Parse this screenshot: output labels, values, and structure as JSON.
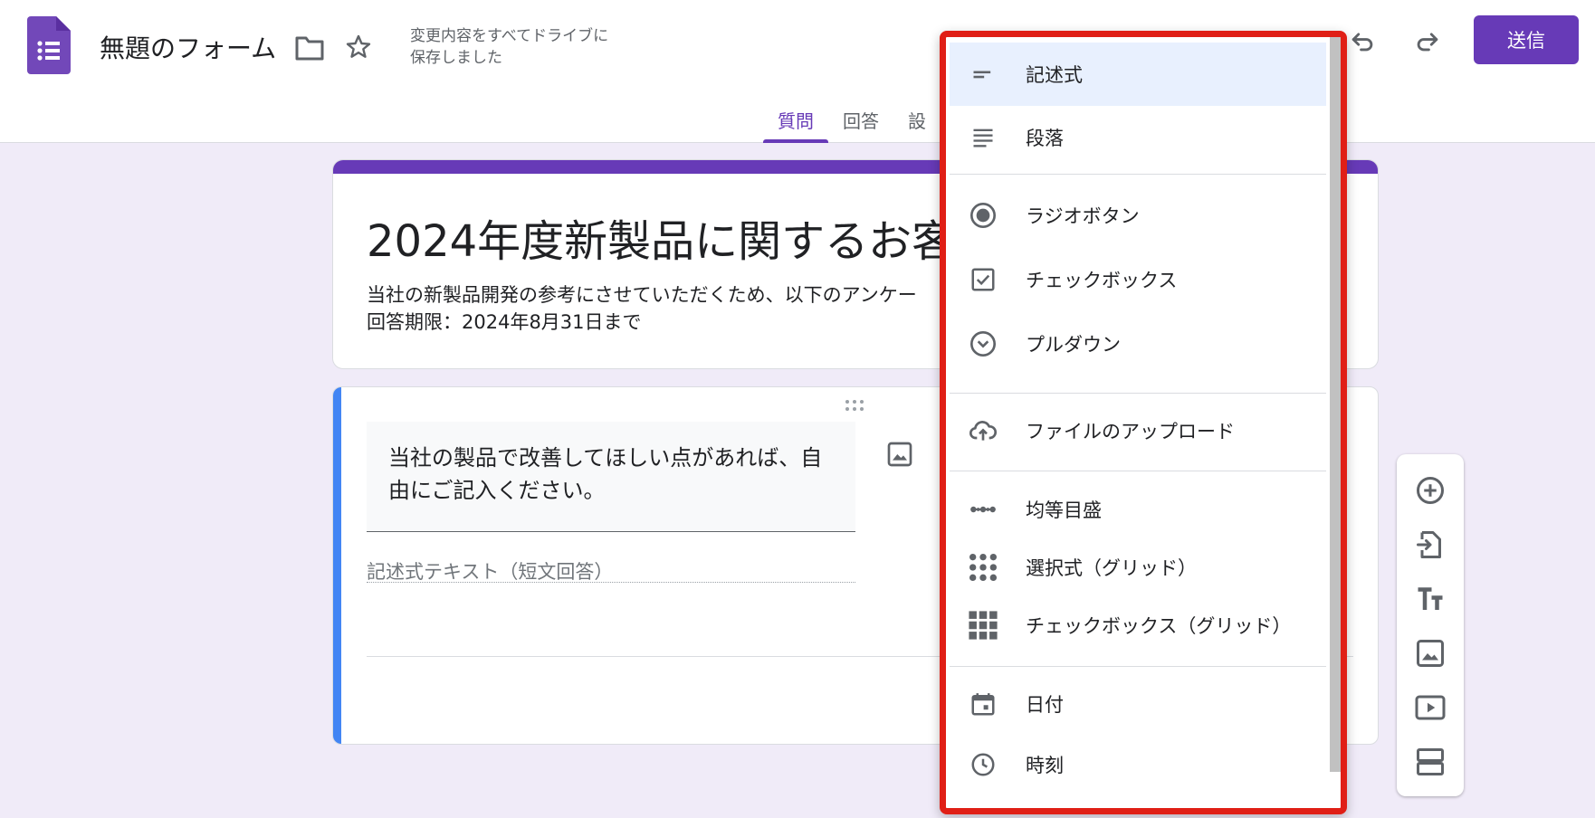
{
  "header": {
    "doc_title": "無題のフォーム",
    "save_status": "変更内容をすべてドライブに\n保存しました",
    "send_label": "送信"
  },
  "tabs": [
    {
      "label": "質問",
      "active": true
    },
    {
      "label": "回答",
      "active": false
    },
    {
      "label": "設",
      "active": false
    }
  ],
  "form": {
    "title": "2024年度新製品に関するお客",
    "description": "当社の新製品開発の参考にさせていただくため、以下のアンケー\n回答期限：2024年8月31日まで"
  },
  "question": {
    "text": "当社の製品で改善してほしい点があれば、自由にご記入ください。",
    "answer_placeholder": "記述式テキスト（短文回答）"
  },
  "question_type_menu": {
    "items": [
      {
        "label": "記述式",
        "icon": "short-answer-icon",
        "selected": true
      },
      {
        "label": "段落",
        "icon": "paragraph-icon"
      },
      {
        "label": "ラジオボタン",
        "icon": "radio-button-icon"
      },
      {
        "label": "チェックボックス",
        "icon": "checkbox-icon"
      },
      {
        "label": "プルダウン",
        "icon": "dropdown-icon"
      },
      {
        "label": "ファイルのアップロード",
        "icon": "cloud-upload-icon"
      },
      {
        "label": "均等目盛",
        "icon": "linear-scale-icon"
      },
      {
        "label": "選択式（グリッド）",
        "icon": "dot-grid-icon"
      },
      {
        "label": "チェックボックス（グリッド）",
        "icon": "square-grid-icon"
      },
      {
        "label": "日付",
        "icon": "calendar-icon"
      },
      {
        "label": "時刻",
        "icon": "clock-icon"
      }
    ]
  },
  "side_toolbar": [
    "add-question-icon",
    "import-questions-icon",
    "add-title-icon",
    "add-image-icon",
    "add-video-icon",
    "add-section-icon"
  ],
  "colors": {
    "accent": "#673ab7",
    "background": "#f0ebf8",
    "highlight_border": "#e01f16",
    "question_accent": "#4285f4"
  }
}
